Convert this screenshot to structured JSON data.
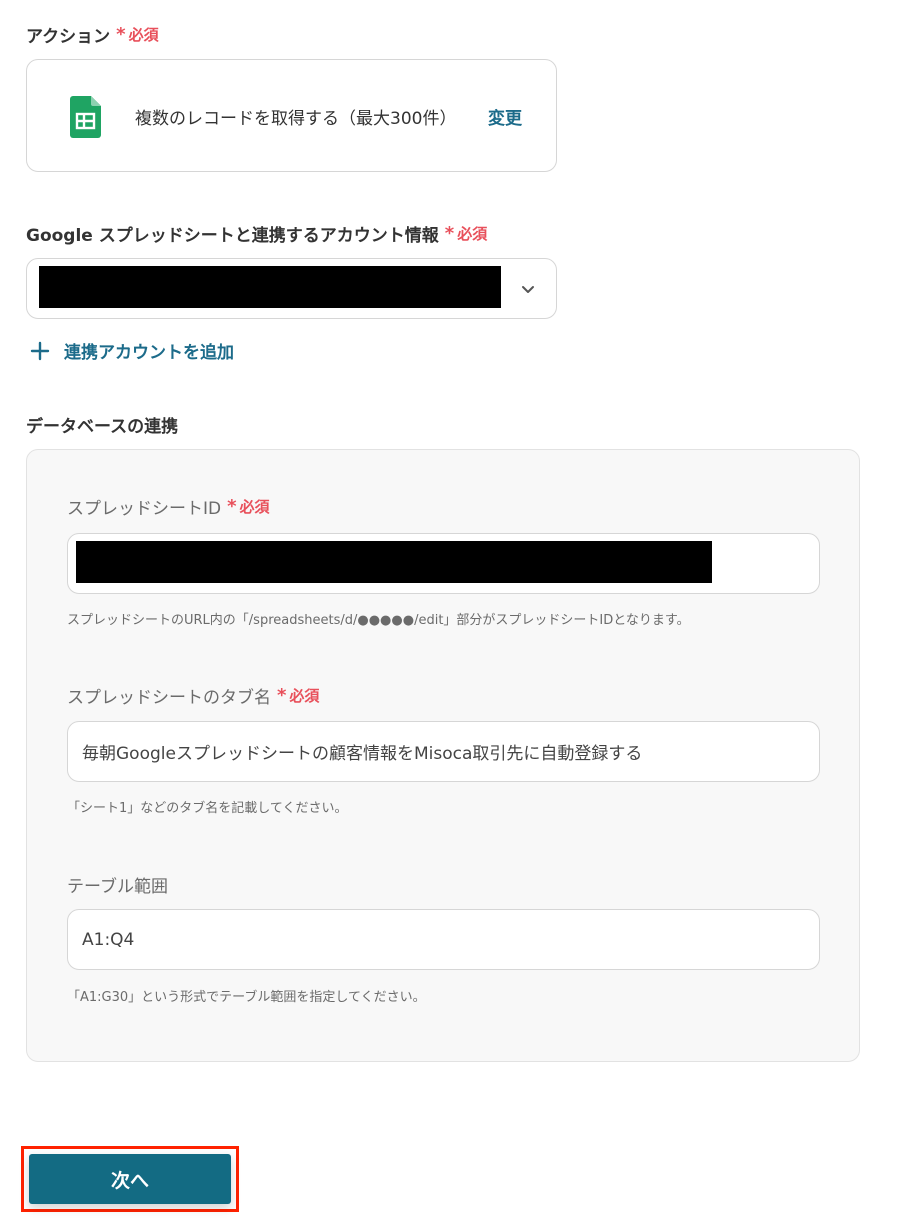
{
  "action": {
    "label": "アクション",
    "required": "必須",
    "card_text": "複数のレコードを取得する（最大300件）",
    "change_label": "変更",
    "icon": "google-sheets-icon"
  },
  "account": {
    "label": "Google スプレッドシートと連携するアカウント情報",
    "required": "必須",
    "add_label": "連携アカウントを追加"
  },
  "database": {
    "section_title": "データベースの連携",
    "spreadsheet_id": {
      "label": "スプレッドシートID",
      "required": "必須",
      "hint": "スプレッドシートのURL内の「/spreadsheets/d/●●●●●/edit」部分がスプレッドシートIDとなります。"
    },
    "tab_name": {
      "label": "スプレッドシートのタブ名",
      "required": "必須",
      "value": "毎朝Googleスプレッドシートの顧客情報をMisoca取引先に自動登録する",
      "hint": "「シート1」などのタブ名を記載してください。"
    },
    "table_range": {
      "label": "テーブル範囲",
      "value": "A1:Q4",
      "hint": "「A1:G30」という形式でテーブル範囲を指定してください。"
    }
  },
  "next_button": {
    "label": "次へ"
  },
  "colors": {
    "accent": "#1c6b8a",
    "button": "#136b83",
    "required": "#e8505b",
    "highlight": "#ff2200"
  }
}
